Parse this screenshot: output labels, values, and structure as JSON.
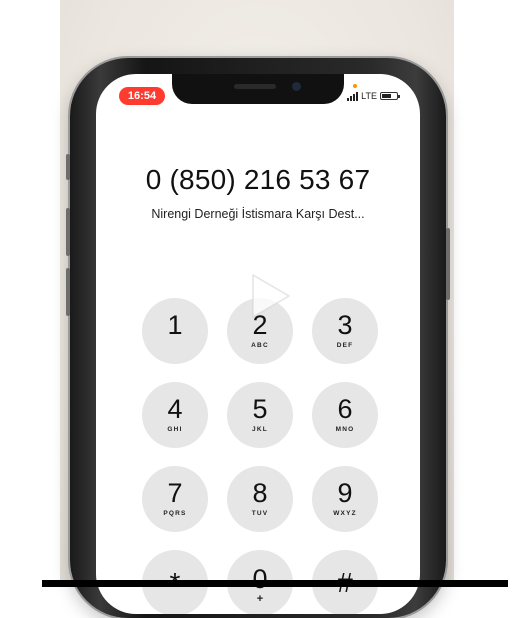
{
  "status_bar": {
    "time": "16:54",
    "network": "LTE"
  },
  "dialer": {
    "number": "0 (850) 216 53 67",
    "contact_name": "Nirengi Derneği İstismara Karşı Dest..."
  },
  "keypad": {
    "keys": [
      {
        "digit": "1",
        "letters": ""
      },
      {
        "digit": "2",
        "letters": "ABC"
      },
      {
        "digit": "3",
        "letters": "DEF"
      },
      {
        "digit": "4",
        "letters": "GHI"
      },
      {
        "digit": "5",
        "letters": "JKL"
      },
      {
        "digit": "6",
        "letters": "MNO"
      },
      {
        "digit": "7",
        "letters": "PQRS"
      },
      {
        "digit": "8",
        "letters": "TUV"
      },
      {
        "digit": "9",
        "letters": "WXYZ"
      },
      {
        "digit": "*",
        "letters": ""
      },
      {
        "digit": "0",
        "letters": "+"
      },
      {
        "digit": "#",
        "letters": ""
      }
    ]
  },
  "colors": {
    "time_pill": "#ff3b30",
    "key_background": "#e6e6e6"
  },
  "icons": {
    "play_overlay": "play-icon"
  }
}
